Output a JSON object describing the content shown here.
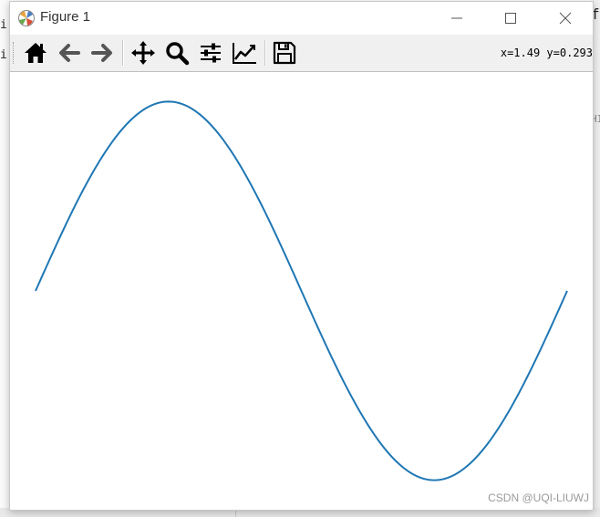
{
  "window": {
    "title": "Figure 1"
  },
  "background": {
    "left_chars": [
      "i",
      "i"
    ],
    "right_chars": [
      "ff",
      "HI"
    ]
  },
  "toolbar": {
    "buttons": [
      {
        "name": "home-button",
        "icon": "home-icon"
      },
      {
        "name": "back-button",
        "icon": "arrow-left-icon"
      },
      {
        "name": "forward-button",
        "icon": "arrow-right-icon"
      },
      {
        "name": "pan-button",
        "icon": "move-icon"
      },
      {
        "name": "zoom-button",
        "icon": "magnifier-icon"
      },
      {
        "name": "configure-subplots-button",
        "icon": "sliders-icon"
      },
      {
        "name": "edit-axes-button",
        "icon": "line-chart-icon"
      },
      {
        "name": "save-button",
        "icon": "floppy-disk-icon"
      }
    ],
    "coords": "x=1.49 y=0.293"
  },
  "chart_data": {
    "type": "line",
    "series": [
      {
        "function": "sin(x)",
        "x_range": [
          0,
          6.2832
        ],
        "samples": 200,
        "color": "#1f77b4"
      }
    ],
    "axes_visible": false,
    "grid": false
  },
  "watermark": "CSDN @UQI-LIUWJ",
  "colors": {
    "line": "#1f77b4",
    "toolbar_bg": "#f0f0f0",
    "canvas_bg": "#ffffff"
  }
}
